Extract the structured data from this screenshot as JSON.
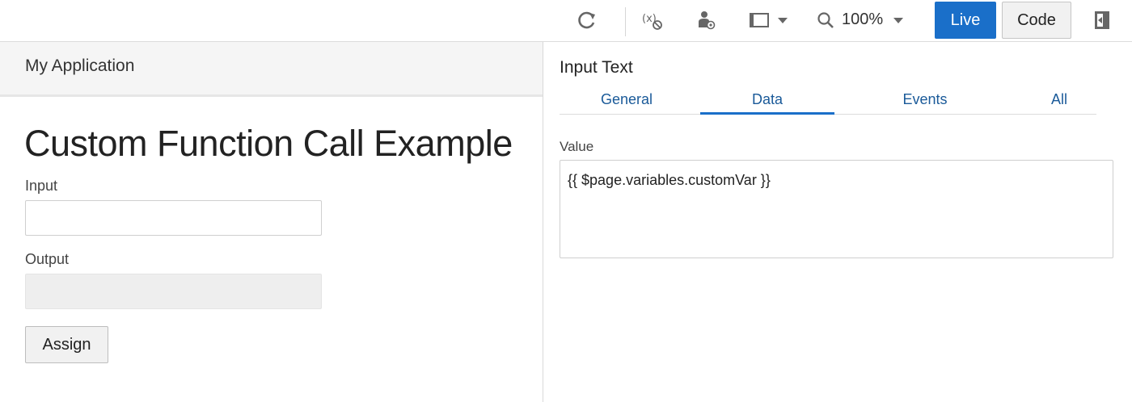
{
  "toolbar": {
    "icons": [
      "refresh-icon",
      "variable-icon",
      "user-role-icon",
      "device-frame-icon",
      "zoom-icon",
      "collapse-panel-icon"
    ],
    "zoom_level": "100%",
    "live_label": "Live",
    "code_label": "Code",
    "accent_color": "#1a6fc9"
  },
  "app": {
    "title": "My Application",
    "page_title": "Custom Function Call Example",
    "input_label": "Input",
    "input_value": "",
    "output_label": "Output",
    "output_value": "",
    "assign_label": "Assign"
  },
  "properties": {
    "title": "Input Text",
    "tabs": [
      {
        "label": "General",
        "active": false
      },
      {
        "label": "Data",
        "active": true
      },
      {
        "label": "Events",
        "active": false
      },
      {
        "label": "All",
        "active": false
      }
    ],
    "value_label": "Value",
    "value": "{{ $page.variables.customVar }}"
  }
}
